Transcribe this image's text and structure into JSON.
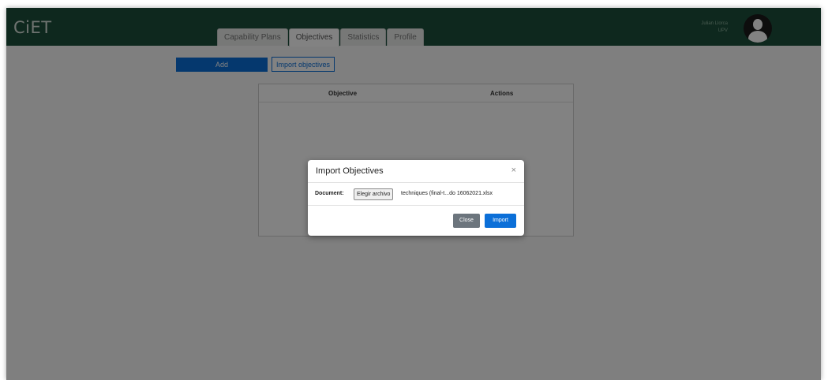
{
  "navbar": {
    "brand": "CiET",
    "tabs": [
      {
        "label": "Capability Plans"
      },
      {
        "label": "Objectives"
      },
      {
        "label": "Statistics"
      },
      {
        "label": "Profile"
      }
    ],
    "active_tab": "Objectives",
    "user": {
      "name": "Julian Llorca",
      "org": "UPV"
    },
    "avatar_icon": "user-avatar-icon"
  },
  "toolbar": {
    "add_label": "Add",
    "import_label": "Import objectives"
  },
  "table": {
    "columns": [
      "Objective",
      "Actions"
    ],
    "rows": []
  },
  "modal": {
    "title": "Import Objectives",
    "close_icon": "close-icon",
    "document_label": "Document:",
    "file_button_label": "Elegir archivo",
    "file_name": "techniques (final-t...do 16062021.xlsx",
    "close_button": "Close",
    "import_button": "Import"
  },
  "colors": {
    "navbar": "#1d4f3b",
    "primary": "#0b6fd8",
    "secondary": "#6c757d",
    "overlay": "rgba(0,0,0,0.49)"
  }
}
